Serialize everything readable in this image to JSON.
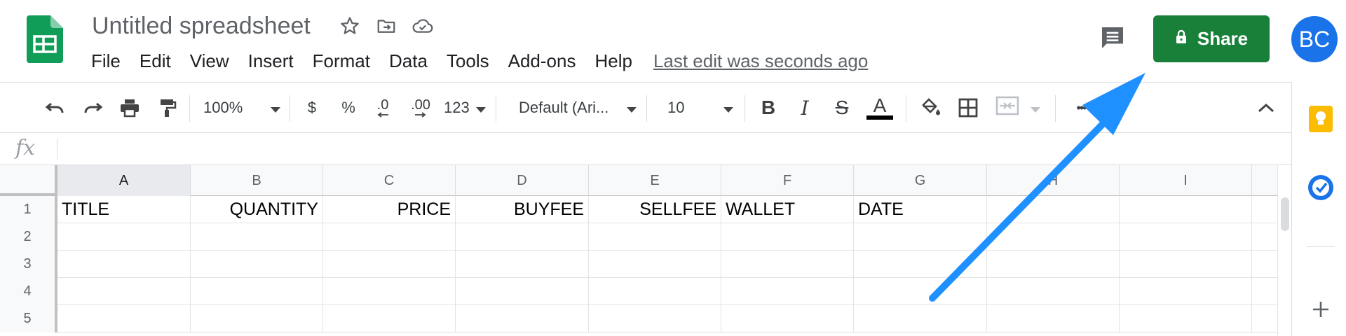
{
  "app": {
    "doc_title": "Untitled spreadsheet",
    "icons": [
      "sheets-logo-icon",
      "star-icon",
      "move-to-folder-icon",
      "cloud-saved-icon"
    ]
  },
  "menu": {
    "items": [
      "File",
      "Edit",
      "View",
      "Insert",
      "Format",
      "Data",
      "Tools",
      "Add-ons",
      "Help"
    ],
    "last_edit": "Last edit was seconds ago"
  },
  "header_right": {
    "share_label": "Share",
    "avatar_initials": "BC",
    "share_color": "#188038",
    "avatar_color": "#1a73e8"
  },
  "toolbar": {
    "zoom": "100%",
    "currency": "$",
    "percent": "%",
    "decrease_decimal": ".0",
    "increase_decimal": ".00",
    "more_formats": "123",
    "font": "Default (Ari...",
    "font_size": "10",
    "bold": "B",
    "italic": "I",
    "strikethrough": "S",
    "text_color_glyph": "A",
    "more": "•••"
  },
  "formula_bar": {
    "fx": "fx",
    "value": ""
  },
  "grid": {
    "columns": [
      "A",
      "B",
      "C",
      "D",
      "E",
      "F",
      "G",
      "H",
      "I"
    ],
    "selected_column": "A",
    "rows": [
      {
        "num": "1",
        "cells": [
          "TITLE",
          "QUANTITY",
          "PRICE",
          "BUYFEE",
          "SELLFEE",
          "WALLET",
          "DATE",
          "",
          ""
        ]
      },
      {
        "num": "2",
        "cells": [
          "",
          "",
          "",
          "",
          "",
          "",
          "",
          "",
          ""
        ]
      },
      {
        "num": "3",
        "cells": [
          "",
          "",
          "",
          "",
          "",
          "",
          "",
          "",
          ""
        ]
      },
      {
        "num": "4",
        "cells": [
          "",
          "",
          "",
          "",
          "",
          "",
          "",
          "",
          ""
        ]
      },
      {
        "num": "5",
        "cells": [
          "",
          "",
          "",
          "",
          "",
          "",
          "",
          "",
          ""
        ]
      }
    ]
  },
  "side_panel": {
    "icons": [
      "keep-icon",
      "tasks-icon",
      "add-icon"
    ]
  },
  "annotation": {
    "arrow_color": "#1e90ff",
    "points_to": "share-button"
  }
}
